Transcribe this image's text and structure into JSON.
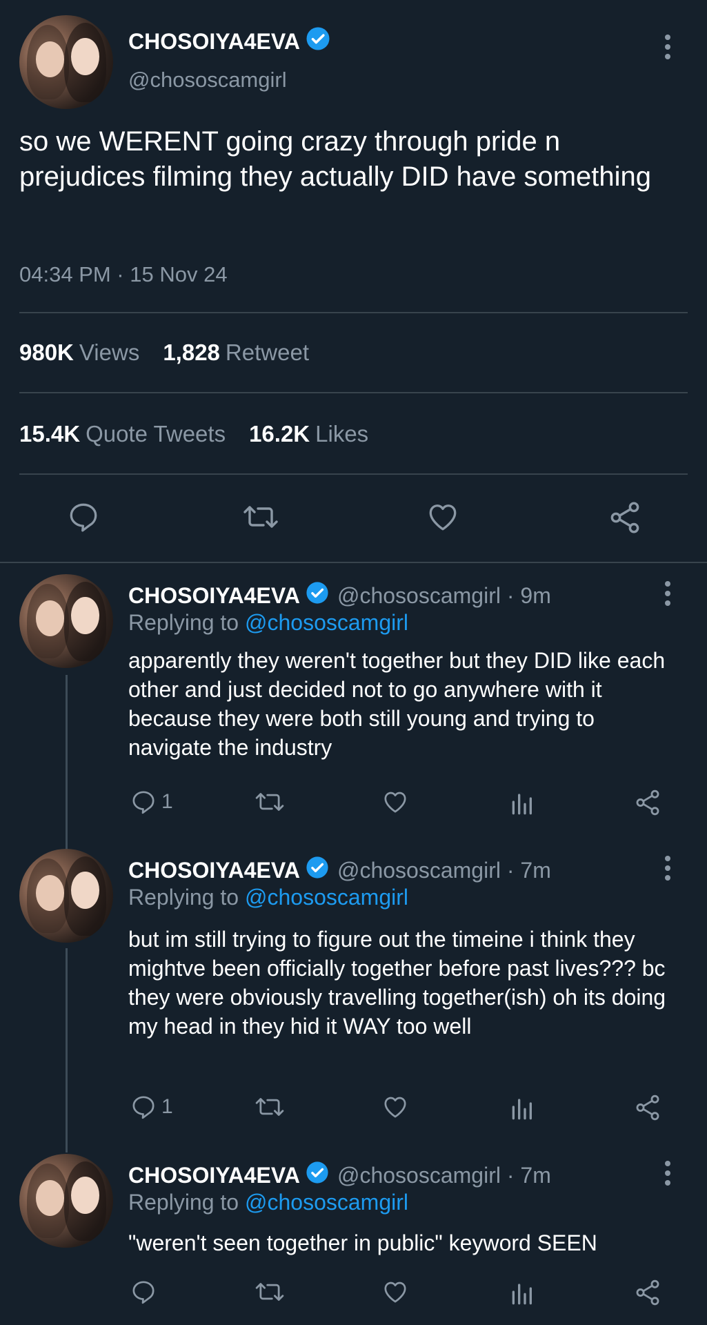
{
  "main_tweet": {
    "display_name": "CHOSOIYA4EVA",
    "handle": "@chososcamgirl",
    "text": "so we WERENT going crazy through pride n prejudices filming they actually DID have something",
    "timestamp": "04:34 PM · 15 Nov 24",
    "views_count": "980K",
    "views_label": "Views",
    "retweets_count": "1,828",
    "retweets_label": "Retweet",
    "quotes_count": "15.4K",
    "quotes_label": "Quote Tweets",
    "likes_count": "16.2K",
    "likes_label": "Likes"
  },
  "replies": [
    {
      "display_name": "CHOSOIYA4EVA",
      "handle": "@chososcamgirl · 9m",
      "replying_prefix": "Replying to",
      "replying_to": "@chososcamgirl",
      "text": "apparently they weren't together but they DID like each other and just decided not to go anywhere with it because they were both still young and trying to navigate the industry",
      "reply_count": "1"
    },
    {
      "display_name": "CHOSOIYA4EVA",
      "handle": "@chososcamgirl · 7m",
      "replying_prefix": "Replying to",
      "replying_to": "@chososcamgirl",
      "text": "but im still trying to figure out the timeine i think they mightve been officially together before past lives??? bc they were obviously travelling together(ish) oh its doing my head in they hid it WAY too well",
      "reply_count": "1"
    },
    {
      "display_name": "CHOSOIYA4EVA",
      "handle": "@chososcamgirl · 7m",
      "replying_prefix": "Replying to",
      "replying_to": "@chososcamgirl",
      "text": "\"weren't seen together in public\" keyword SEEN",
      "reply_count": ""
    }
  ],
  "colors": {
    "background": "#15202b",
    "secondary_text": "#8b98a5",
    "accent": "#1d9bf0",
    "divider": "#38444d"
  },
  "icons": [
    "verified-badge-icon",
    "more-vertical-icon",
    "reply-icon",
    "retweet-icon",
    "like-icon",
    "share-icon",
    "analytics-icon"
  ]
}
